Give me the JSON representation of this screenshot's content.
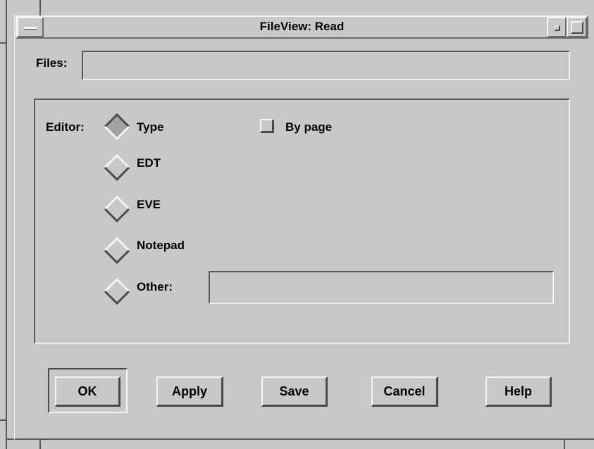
{
  "window": {
    "title": "FileView: Read"
  },
  "files": {
    "label": "Files:",
    "value": ""
  },
  "editor": {
    "label": "Editor:",
    "options": [
      "Type",
      "EDT",
      "EVE",
      "Notepad",
      "Other:"
    ],
    "selected": "Type",
    "other_value": "",
    "by_page_label": "By page",
    "by_page_checked": false
  },
  "buttons": {
    "ok": "OK",
    "apply": "Apply",
    "save": "Save",
    "cancel": "Cancel",
    "help": "Help"
  },
  "icons": {
    "window_menu": "window-menu-icon",
    "minimize": "minimize-icon",
    "maximize": "maximize-icon"
  }
}
